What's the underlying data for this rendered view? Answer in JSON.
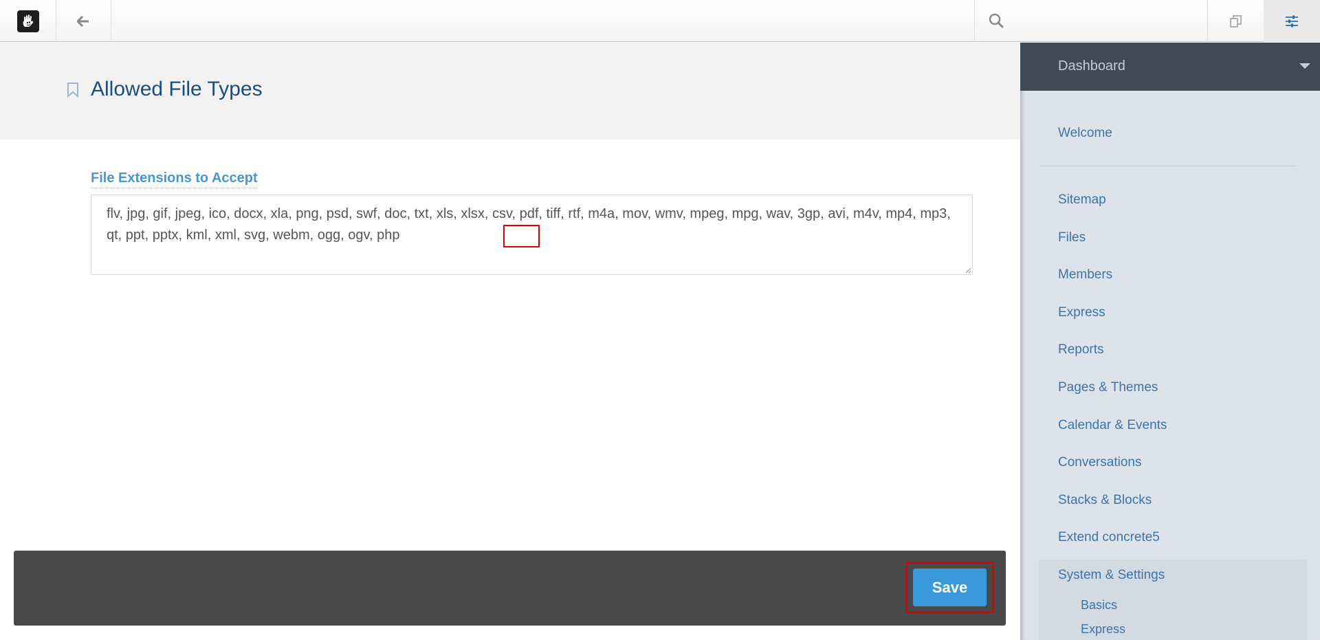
{
  "toolbar": {
    "logo": "concrete5-hand-logo",
    "back_icon": "arrow-left-icon",
    "search": {
      "placeholder": "",
      "value": ""
    },
    "intelligent_search_icon": "copy-pages-icon",
    "dashboard_icon": "sliders-icon"
  },
  "header": {
    "title": "Allowed File Types",
    "bookmark_icon": "bookmark-icon"
  },
  "form": {
    "field_label": "File Extensions to Accept",
    "extensions_value": "flv, jpg, gif, jpeg, ico, docx, xla, png, psd, swf, doc, txt, xls, xlsx, csv, pdf, tiff, rtf, m4a, mov, wmv, mpeg, mpg, wav, 3gp, avi, m4v, mp4, mp3, qt, ppt, pptx, kml, xml, svg, webm, ogg, ogv, php"
  },
  "footer": {
    "save_label": "Save"
  },
  "sidebar": {
    "header": "Dashboard",
    "items": [
      {
        "label": "Welcome"
      },
      {
        "label": "Sitemap"
      },
      {
        "label": "Files"
      },
      {
        "label": "Members"
      },
      {
        "label": "Express"
      },
      {
        "label": "Reports"
      },
      {
        "label": "Pages & Themes"
      },
      {
        "label": "Calendar & Events"
      },
      {
        "label": "Conversations"
      },
      {
        "label": "Stacks & Blocks"
      },
      {
        "label": "Extend concrete5"
      },
      {
        "label": "System & Settings"
      }
    ],
    "sub_items": [
      {
        "label": "Basics"
      },
      {
        "label": "Express"
      }
    ]
  },
  "colors": {
    "accent": "#3a9ad9",
    "title": "#1a4d7c",
    "panel_header": "#3e4a55",
    "panel_bg": "#dde3ea",
    "highlight": "#e00000"
  }
}
